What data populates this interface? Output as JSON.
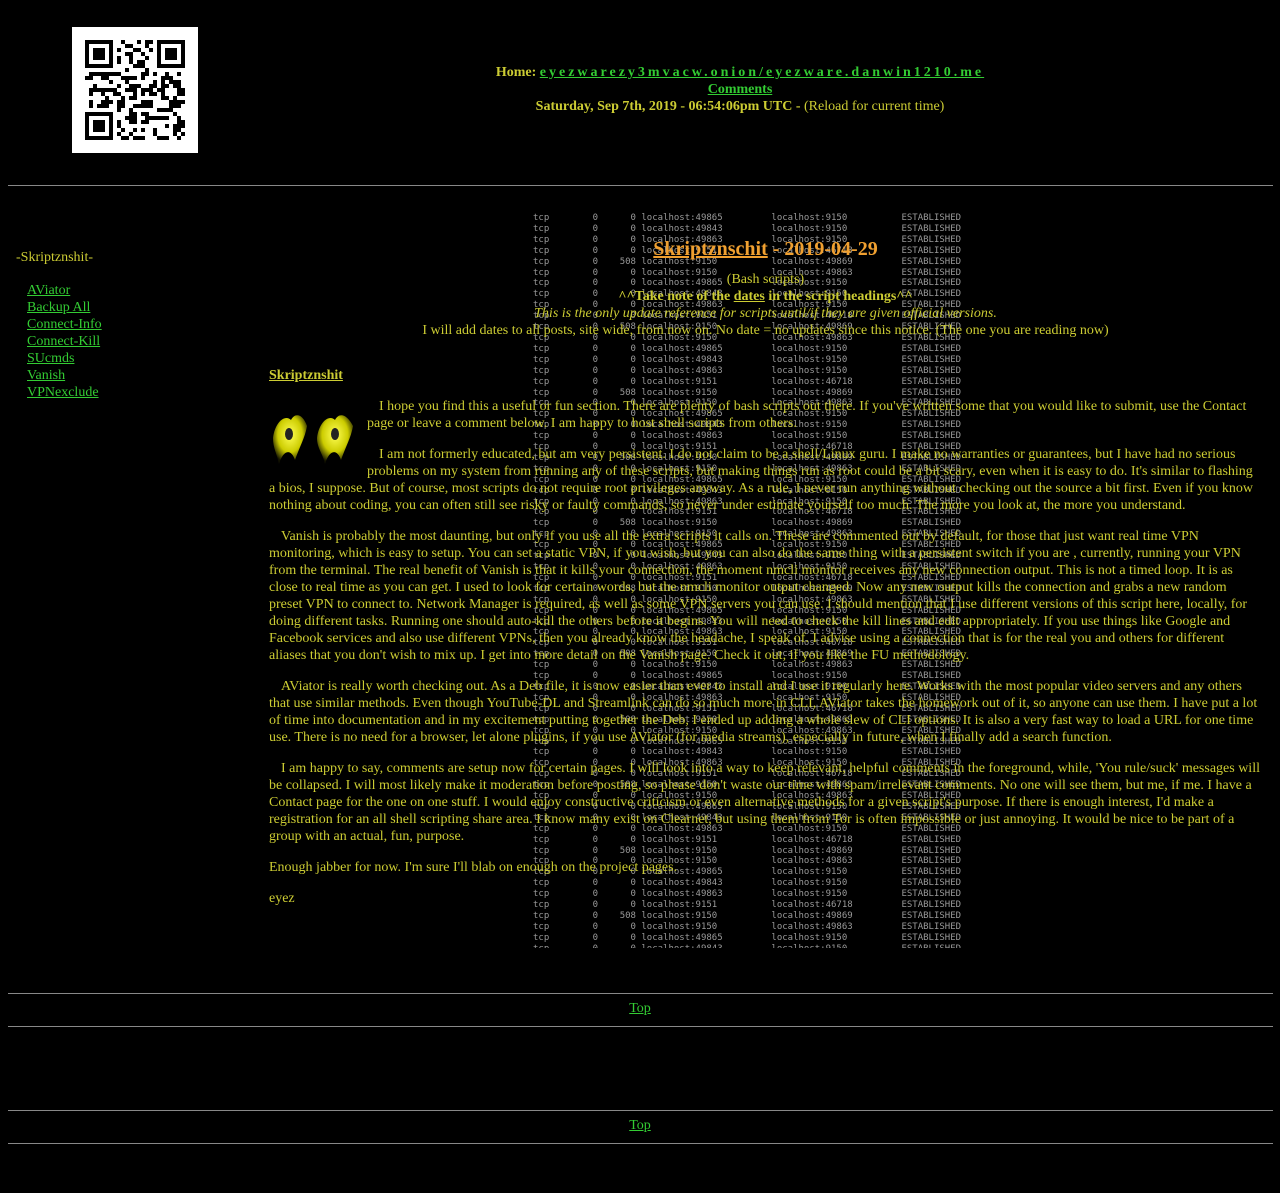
{
  "header": {
    "home_label": "Home:",
    "home_link": "eyezwarezy3mvacw.onion/eyezware.danwin1210.me",
    "comments_link": "Comments",
    "timestamp": "Saturday, Sep 7th, 2019 - 06:54:06pm UTC -",
    "reload_note": "(Reload for current time)"
  },
  "sidebar": {
    "title": "-Skriptznshit-",
    "items": [
      {
        "label": "AViator"
      },
      {
        "label": "Backup All"
      },
      {
        "label": "Connect-Info"
      },
      {
        "label": "Connect-Kill"
      },
      {
        "label": "SUcmds"
      },
      {
        "label": "Vanish"
      },
      {
        "label": "VPNexclude"
      }
    ]
  },
  "main": {
    "title_link": "Skriptznschit",
    "title_date": " - 2019-04-29",
    "subtitle": "(Bash scripts)",
    "warning_prefix": "^^Take note of the ",
    "warning_link": "dates",
    "warning_suffix": " in the script headings^^",
    "italic_note": "This is the only update reference for scripts until/if they are given official versions.",
    "dates_note": "I will add dates to all posts, site wide, from now on. No date = no updates since this notice. (The one you are reading now)",
    "section_heading": "Skriptznshit",
    "paragraphs": [
      "I hope you find this a useful or fun section. There are plenty of bash scripts out there. If you've written some that you would like to submit, use the Contact page or leave a comment below. I am happy to host shell scripts from others.",
      "I am not formerly educated, but am very persistent. I do not claim to be a shell/Linux guru. I make no warranties or guarantees, but I have had no serious problems on my system from running any of these scripts, but making things run as root could be a bit scary, even when it is easy to do. It's similar to flashing a bios, I suppose. But of course, most scripts do not require root privileges anyway. As a rule, I never run anything without checking out the source a bit first. Even if you know nothing about coding, you can often still see risky or faulty commands, so never under estimate yourself too much. The more you look at, the more you understand.",
      "Vanish is probably the most daunting, but only if you use all the extra scripts it calls on. These are commented out by default, for those that just want real time VPN monitoring, which is easy to setup. You can set a static VPN, if you wish, but you can also do the same thing with a persistent switch if you are , currently, running your VPN from the terminal. The real benefit of Vanish is that it kills your connection, the moment nmcli monitor receives any new connection output. This is not a timed loop. It is as close to real time as you can get. I used to look for certain words, but the nmcli monitor output changed. Now any new output kills the connection and grabs a new random preset VPN to connect to. Network Manager is required, as well as some VPN servers you can use. I should mention that I use different versions of this script here, locally, for doing different tasks. Running one should auto-kill the others before it begins. You will need to check the kill lines and edit appropriately. If you use things like Google and Facebook services and also use different VPNs, then you already know the headache, I speak of. I advise using a connection that is for the real you and others for different aliases that you don't wish to mix up. I get into more detail on the Vanish page. Check it out, if you like the FU methodology.",
      "AViator is really worth checking out. As a Deb file, it is now easier than ever to install and I use it regularly here. Works with the most popular video servers and any others that use similar methods. Even though YouTube-DL and Streamlink can do so much more in CLI, AViator takes the homework out of it, so anyone can use them. I have put a lot of time into documentation and in my excitement putting together the Deb, I ended up adding a whole slew of CLI options. It is also a very fast way to load a URL for one time use. There is no need for a browser, let alone plugins, if you use AViator (for media streams), especially in future, when I finally add a search function.",
      "I am happy to say, comments are setup now for certain pages. I will look into a way to keep relevant, helpful comments in the foreground, while, 'You rule/suck' messages will be collapsed. I will most likely make it moderation before posting, so please don't waste our time with spam/irrelevant comments. No one will see them, but me, if me. I have a Contact page for the one on one stuff. I would enjoy constructive criticism or even alternative methods for a given script's purpose. If there is enough interest, I'd make a registration for an all shell scripting share area. I know many exist on Clearnet, but using them from Tor is often impossible or just annoying. It would be nice to be part of a group with an actual, fun, purpose.",
      "Enough jabber for now. I'm sure I'll blab on enough on the project pages."
    ],
    "signature": "eyez"
  },
  "terminal": {
    "lines": [
      "tcp        0      0 localhost:49865         localhost:9150          ESTABLISHED",
      "tcp        0      0 localhost:49843         localhost:9150          ESTABLISHED",
      "tcp        0      0 localhost:49863         localhost:9150          ESTABLISHED",
      "tcp        0      0 localhost:9151          localhost:46718         ESTABLISHED",
      "tcp        0    508 localhost:9150          localhost:49869         ESTABLISHED",
      "tcp        0      0 localhost:9150          localhost:49863         ESTABLISHED",
      "tcp        0      0 localhost:49865         localhost:9150          ESTABLISHED",
      "tcp        0      0 localhost:49843         localhost:9150          ESTABLISHED",
      "tcp        0      0 localhost:49863         localhost:9150          ESTABLISHED",
      "tcp        0      0 localhost:9151          localhost:46718         ESTABLISHED",
      "tcp        0    508 localhost:9150          localhost:49869         ESTABLISHED",
      "tcp        0      0 localhost:9150          localhost:49863         ESTABLISHED",
      "tcp        0      0 localhost:49865         localhost:9150          ESTABLISHED",
      "tcp        0      0 localhost:49843         localhost:9150          ESTABLISHED",
      "tcp        0      0 localhost:49863         localhost:9150          ESTABLISHED",
      "tcp        0      0 localhost:9151          localhost:46718         ESTABLISHED",
      "tcp        0    508 localhost:9150          localhost:49869         ESTABLISHED",
      "tcp        0      0 localhost:9150          localhost:49863         ESTABLISHED"
    ]
  },
  "footer": {
    "top_link_1": "Top",
    "top_link_2": "Top"
  }
}
